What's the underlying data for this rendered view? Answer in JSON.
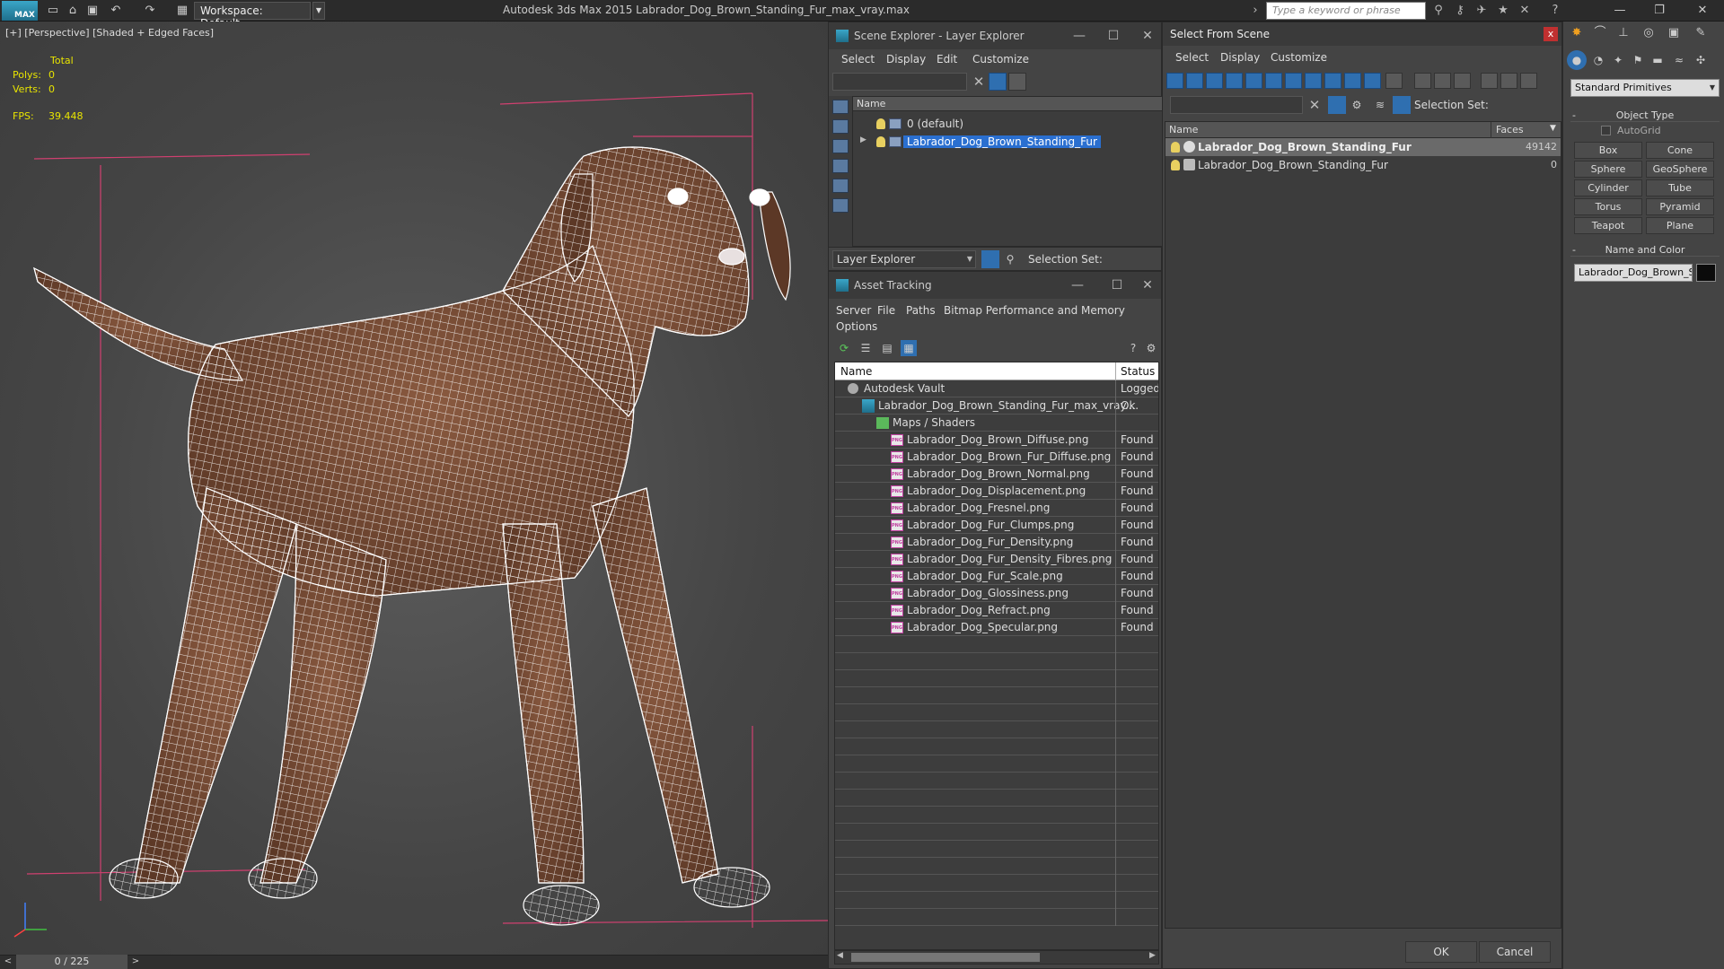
{
  "titlebar": {
    "logo": "MAX",
    "workspace": "Workspace: Default",
    "app_title": "Autodesk 3ds Max  2015    Labrador_Dog_Brown_Standing_Fur_max_vray.max",
    "search_placeholder": "Type a keyword or phrase"
  },
  "viewport": {
    "label": "[+] [Perspective] [Shaded + Edged Faces]",
    "stats": {
      "total_label": "Total",
      "polys_label": "Polys:",
      "polys_value": "0",
      "verts_label": "Verts:",
      "verts_value": "0",
      "fps_label": "FPS:",
      "fps_value": "39.448"
    },
    "frame_counter": "0 / 225",
    "prev": "<",
    "next": ">",
    "wire_color": "#ffffff",
    "body_color": "#7a5038",
    "bbox_color": "#d04070"
  },
  "scene_explorer": {
    "title": "Scene Explorer - Layer Explorer",
    "menu": [
      "Select",
      "Display",
      "Edit",
      "Customize"
    ],
    "column": "Name",
    "rows": [
      "0 (default)",
      "Labrador_Dog_Brown_Standing_Fur"
    ],
    "footer_combo": "Layer Explorer",
    "selection_set": "Selection Set:"
  },
  "asset_tracking": {
    "title": "Asset Tracking",
    "menu": [
      "Server",
      "File",
      "Paths",
      "Bitmap Performance and Memory",
      "Options"
    ],
    "columns": [
      "Name",
      "Status"
    ],
    "rows": [
      {
        "name": "Autodesk Vault",
        "status": "Logged",
        "indent": 0,
        "kind": "vault"
      },
      {
        "name": "Labrador_Dog_Brown_Standing_Fur_max_vray....",
        "status": "Ok",
        "indent": 1,
        "kind": "file"
      },
      {
        "name": "Maps / Shaders",
        "status": "",
        "indent": 2,
        "kind": "folder"
      },
      {
        "name": "Labrador_Dog_Brown_Diffuse.png",
        "status": "Found",
        "indent": 3,
        "kind": "png"
      },
      {
        "name": "Labrador_Dog_Brown_Fur_Diffuse.png",
        "status": "Found",
        "indent": 3,
        "kind": "png"
      },
      {
        "name": "Labrador_Dog_Brown_Normal.png",
        "status": "Found",
        "indent": 3,
        "kind": "png"
      },
      {
        "name": "Labrador_Dog_Displacement.png",
        "status": "Found",
        "indent": 3,
        "kind": "png"
      },
      {
        "name": "Labrador_Dog_Fresnel.png",
        "status": "Found",
        "indent": 3,
        "kind": "png"
      },
      {
        "name": "Labrador_Dog_Fur_Clumps.png",
        "status": "Found",
        "indent": 3,
        "kind": "png"
      },
      {
        "name": "Labrador_Dog_Fur_Density.png",
        "status": "Found",
        "indent": 3,
        "kind": "png"
      },
      {
        "name": "Labrador_Dog_Fur_Density_Fibres.png",
        "status": "Found",
        "indent": 3,
        "kind": "png"
      },
      {
        "name": "Labrador_Dog_Fur_Scale.png",
        "status": "Found",
        "indent": 3,
        "kind": "png"
      },
      {
        "name": "Labrador_Dog_Glossiness.png",
        "status": "Found",
        "indent": 3,
        "kind": "png"
      },
      {
        "name": "Labrador_Dog_Refract.png",
        "status": "Found",
        "indent": 3,
        "kind": "png"
      },
      {
        "name": "Labrador_Dog_Specular.png",
        "status": "Found",
        "indent": 3,
        "kind": "png"
      }
    ],
    "empty_rows": 17,
    "png_badge": "PNG"
  },
  "select_from_scene": {
    "title": "Select From Scene",
    "close": "x",
    "menu": [
      "Select",
      "Display",
      "Customize"
    ],
    "selection_set": "Selection Set:",
    "columns": [
      "Name",
      "Faces"
    ],
    "rows": [
      {
        "name": "Labrador_Dog_Brown_Standing_Fur",
        "faces": "49142"
      },
      {
        "name": "Labrador_Dog_Brown_Standing_Fur",
        "faces": "0"
      }
    ],
    "ok": "OK",
    "cancel": "Cancel"
  },
  "command_panel": {
    "category": "Standard Primitives",
    "object_type_title": "Object Type",
    "autogrid": "AutoGrid",
    "buttons": [
      "Box",
      "Cone",
      "Sphere",
      "GeoSphere",
      "Cylinder",
      "Tube",
      "Torus",
      "Pyramid",
      "Teapot",
      "Plane"
    ],
    "name_color_title": "Name and Color",
    "object_name": "Labrador_Dog_Brown_Standing_Fur",
    "object_color": "#0b0b0b"
  }
}
